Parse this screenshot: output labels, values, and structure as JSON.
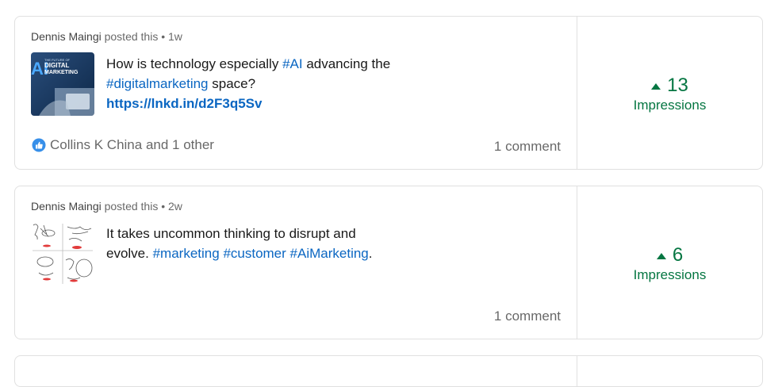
{
  "posts": [
    {
      "author": "Dennis Maingi",
      "posted_suffix": " posted this • 1w",
      "thumb_lines": [
        "AI",
        "THE FUTURE OF",
        "DIGITAL",
        "MARKETING"
      ],
      "text": {
        "p1": "How is technology especially ",
        "tag1": "#AI",
        "p2": " advancing the ",
        "tag2": "#digitalmarketing",
        "p3": " space?",
        "link": "https://lnkd.in/d2F3q5Sv"
      },
      "reactions": "Collins K China and 1 other",
      "comments": "1 comment",
      "impressions_count": "13",
      "impressions_label": "Impressions",
      "impressions_trend": "up"
    },
    {
      "author": "Dennis Maingi",
      "posted_suffix": " posted this • 2w",
      "text": {
        "p1": "It takes uncommon thinking to disrupt and evolve. ",
        "tag1": "#marketing",
        "tag2": "#customer",
        "tag3": "#AiMarketing",
        "end": "."
      },
      "comments": "1 comment",
      "impressions_count": "6",
      "impressions_label": "Impressions",
      "impressions_trend": "up"
    }
  ],
  "colors": {
    "link": "#0a66c2",
    "impressions": "#057642",
    "border": "#e0e0e0"
  }
}
